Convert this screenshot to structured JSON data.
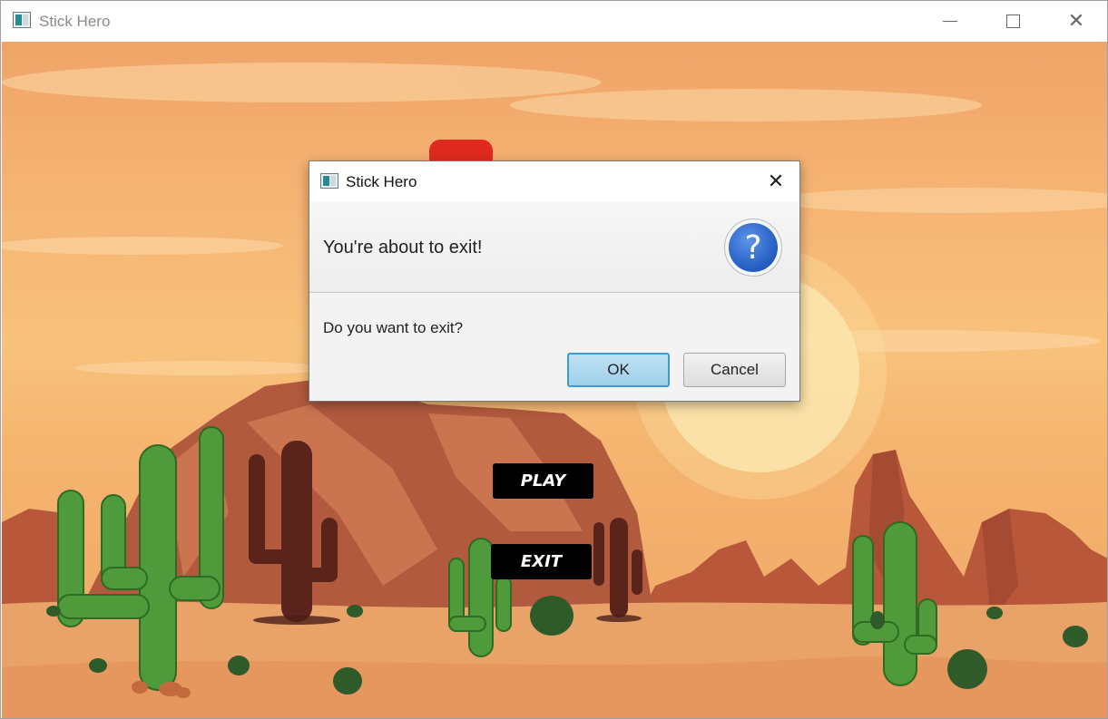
{
  "window": {
    "title": "Stick Hero",
    "icon": "app-icon",
    "controls": [
      "minimize-icon",
      "maximize-icon",
      "close-icon"
    ],
    "close_glyph": "✕"
  },
  "game": {
    "play_label": "PLAY",
    "exit_label": "EXIT",
    "button_color": "#000000"
  },
  "dialog": {
    "title": "Stick Hero",
    "close_glyph": "✕",
    "header_text": "You're about to exit!",
    "icon": "question-icon",
    "icon_glyph": "?",
    "content_text": "Do you want to exit?",
    "ok_label": "OK",
    "cancel_label": "Cancel",
    "ok_color": "#3c9bd6"
  }
}
